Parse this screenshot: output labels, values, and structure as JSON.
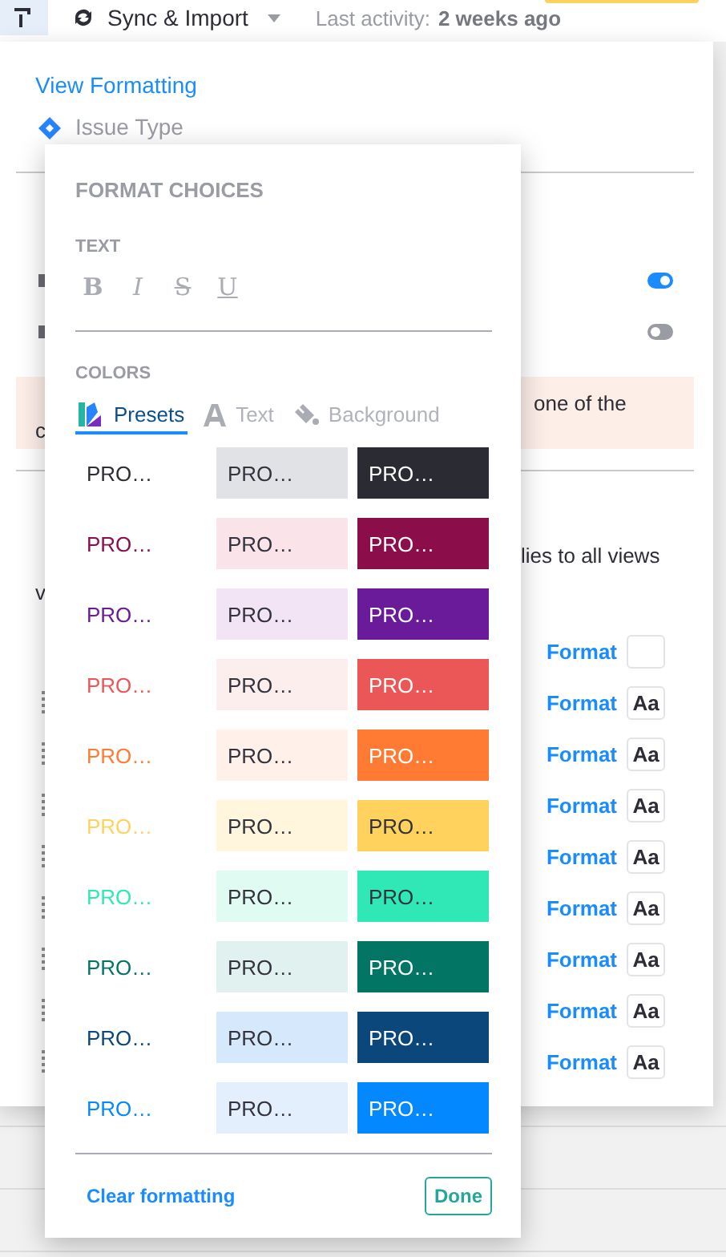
{
  "toolbar": {
    "sync_label": "Sync & Import",
    "activity_label": "Last activity:",
    "activity_value": "2 weeks ago"
  },
  "panel": {
    "link": "View Formatting",
    "field": "Issue Type",
    "toggles": [
      {
        "on": true
      },
      {
        "on": false
      }
    ],
    "banner": {
      "end": "one of the",
      "line2": "c"
    },
    "description": {
      "end": "lies to all views",
      "line2": "v"
    },
    "format_rows": [
      {
        "link": "Format"
      },
      {
        "link": "Format",
        "sample": "Aa"
      },
      {
        "link": "Format",
        "sample": "Aa"
      },
      {
        "link": "Format",
        "sample": "Aa"
      },
      {
        "link": "Format",
        "sample": "Aa"
      },
      {
        "link": "Format",
        "sample": "Aa"
      },
      {
        "link": "Format",
        "sample": "Aa"
      },
      {
        "link": "Format",
        "sample": "Aa"
      },
      {
        "link": "Format",
        "sample": "Aa"
      }
    ]
  },
  "popup": {
    "title": "FORMAT CHOICES",
    "text_heading": "TEXT",
    "text_styles": [
      {
        "label": "B",
        "kind": "bold"
      },
      {
        "label": "I",
        "kind": "italic"
      },
      {
        "label": "S",
        "kind": "strike"
      },
      {
        "label": "U",
        "kind": "underline"
      }
    ],
    "colors_heading": "COLORS",
    "tabs": [
      {
        "label": "Presets",
        "kind": "presets",
        "selected": true
      },
      {
        "label": "Text",
        "kind": "text",
        "selected": false
      },
      {
        "label": "Background",
        "kind": "background",
        "selected": false
      }
    ],
    "swatch_rows": [
      [
        {
          "label": "PRO…",
          "kind": "text",
          "color": "#2d2d36"
        },
        {
          "label": "PRO…",
          "kind": "fill",
          "color": "#e1e2e6"
        },
        {
          "label": "PRO…",
          "kind": "fill-inverse",
          "color": "#2b2b33"
        }
      ],
      [
        {
          "label": "PRO…",
          "kind": "text",
          "color": "#8b0e4b"
        },
        {
          "label": "PRO…",
          "kind": "fill",
          "color": "#fbe3ea"
        },
        {
          "label": "PRO…",
          "kind": "fill-inverse",
          "color": "#8b0e4b"
        }
      ],
      [
        {
          "label": "PRO…",
          "kind": "text",
          "color": "#6a1b9a"
        },
        {
          "label": "PRO…",
          "kind": "fill",
          "color": "#f2e4f4"
        },
        {
          "label": "PRO…",
          "kind": "fill-inverse",
          "color": "#6a1b9a"
        }
      ],
      [
        {
          "label": "PRO…",
          "kind": "text",
          "color": "#eb5757"
        },
        {
          "label": "PRO…",
          "kind": "fill",
          "color": "#fdeeee"
        },
        {
          "label": "PRO…",
          "kind": "fill-inverse",
          "color": "#eb5757"
        }
      ],
      [
        {
          "label": "PRO…",
          "kind": "text",
          "color": "#ff7b33"
        },
        {
          "label": "PRO…",
          "kind": "fill",
          "color": "#fff0ea"
        },
        {
          "label": "PRO…",
          "kind": "fill-inverse",
          "color": "#ff7b33"
        }
      ],
      [
        {
          "label": "PRO…",
          "kind": "text",
          "color": "#ffd25e"
        },
        {
          "label": "PRO…",
          "kind": "fill",
          "color": "#fff6dd"
        },
        {
          "label": "PRO…",
          "kind": "fill",
          "color": "#ffd25e"
        }
      ],
      [
        {
          "label": "PRO…",
          "kind": "text",
          "color": "#2fe8b5"
        },
        {
          "label": "PRO…",
          "kind": "fill",
          "color": "#e0fbf2"
        },
        {
          "label": "PRO…",
          "kind": "fill",
          "color": "#2fe8b5"
        }
      ],
      [
        {
          "label": "PRO…",
          "kind": "text",
          "color": "#037565"
        },
        {
          "label": "PRO…",
          "kind": "fill",
          "color": "#e0f1ef"
        },
        {
          "label": "PRO…",
          "kind": "fill-inverse",
          "color": "#037565"
        }
      ],
      [
        {
          "label": "PRO…",
          "kind": "text",
          "color": "#0c477c"
        },
        {
          "label": "PRO…",
          "kind": "fill",
          "color": "#d6e9fc"
        },
        {
          "label": "PRO…",
          "kind": "fill-inverse",
          "color": "#0c477c"
        }
      ],
      [
        {
          "label": "PRO…",
          "kind": "text",
          "color": "#0488ff"
        },
        {
          "label": "PRO…",
          "kind": "fill",
          "color": "#e3effc"
        },
        {
          "label": "PRO…",
          "kind": "fill-inverse",
          "color": "#0488ff"
        }
      ]
    ],
    "clear_link": "Clear formatting",
    "done_button": "Done"
  }
}
